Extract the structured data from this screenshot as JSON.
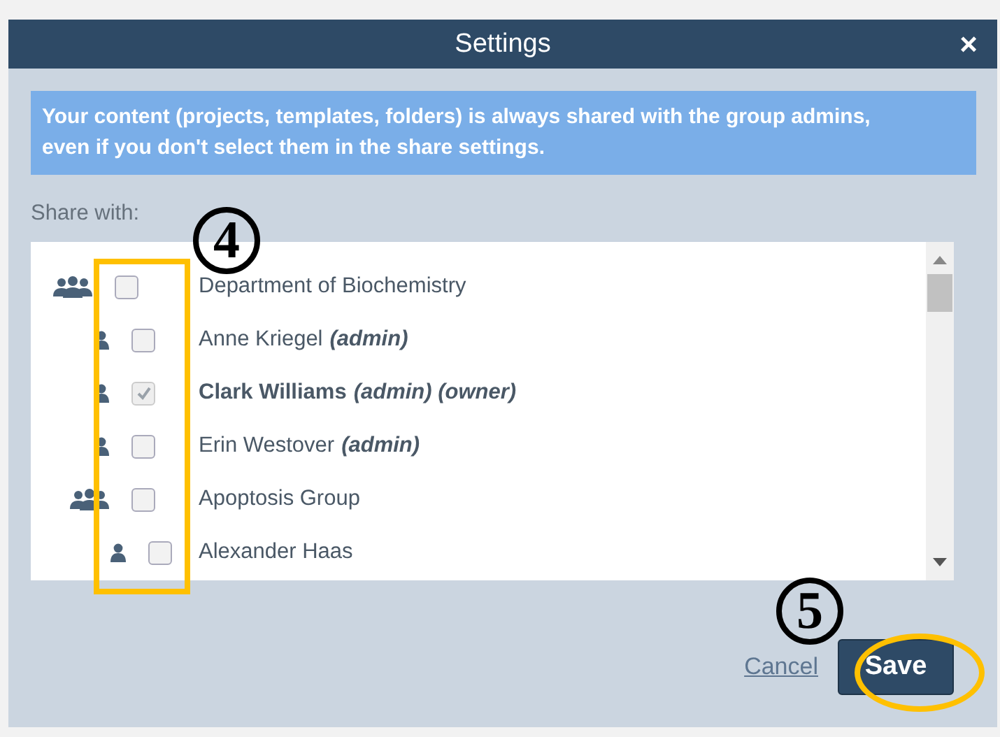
{
  "window": {
    "title": "Settings",
    "close": "×"
  },
  "notice": "Your content (projects, templates, folders) is always shared with the group admins, even if you don't select them in the share settings.",
  "share_label": "Share with:",
  "tree": [
    {
      "kind": "group",
      "name": "Department of Biochemistry",
      "checked": false,
      "bold": false,
      "children": [
        {
          "kind": "person",
          "name": "Anne Kriegel",
          "role": "(admin)",
          "checked": false,
          "bold": false
        },
        {
          "kind": "person",
          "name": "Clark Williams",
          "role": "(admin) (owner)",
          "checked": true,
          "bold": true
        },
        {
          "kind": "person",
          "name": "Erin Westover",
          "role": "(admin)",
          "checked": false,
          "bold": false
        },
        {
          "kind": "group",
          "name": "Apoptosis Group",
          "checked": false,
          "bold": false,
          "children": [
            {
              "kind": "person",
              "name": "Alexander Haas",
              "checked": false,
              "bold": false
            }
          ]
        }
      ]
    }
  ],
  "buttons": {
    "cancel": "Cancel",
    "save": "Save"
  },
  "annotations": [
    {
      "kind": "box-circle",
      "label": "4"
    },
    {
      "kind": "ellipse-circle",
      "label": "5"
    }
  ]
}
